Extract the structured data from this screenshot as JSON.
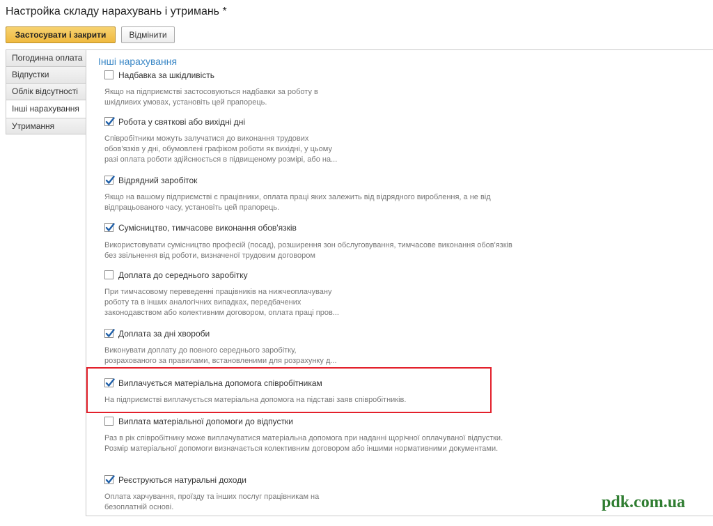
{
  "window": {
    "title": "Настройка складу нарахувань і утримань *"
  },
  "toolbar": {
    "apply_close_label": "Застосувати і закрити",
    "cancel_label": "Відмінити"
  },
  "tabs": [
    {
      "label": "Погодинна оплата",
      "active": false
    },
    {
      "label": "Відпустки",
      "active": false
    },
    {
      "label": "Облік відсутності",
      "active": false
    },
    {
      "label": "Інші нарахування",
      "active": true
    },
    {
      "label": "Утримання",
      "active": false
    }
  ],
  "section": {
    "title": "Інші нарахування"
  },
  "options": [
    {
      "label": "Надбавка за шкідливість",
      "checked": false,
      "description": "Якщо на підприємстві застосовуються надбавки за роботу в\nшкідливих умовах, установіть цей прапорець."
    },
    {
      "label": "Робота у святкові або вихідні дні",
      "checked": true,
      "description": "Співробітники можуть залучатися до виконання трудових\nобов'язків у дні, обумовлені графіком роботи як вихідні, у цьому\nразі оплата роботи здійснюється в підвищеному розмірі, або на..."
    },
    {
      "label": "Відрядний заробіток",
      "checked": true,
      "description": "Якщо на вашому підприємстві є працівники, оплата праці яких залежить від відрядного вироблення, а не від\nвідпрацьованого часу, установіть цей прапорець."
    },
    {
      "label": "Сумісництво, тимчасове виконання обов'язків",
      "checked": true,
      "description": "Використовувати сумісництво професій (посад), розширення зон обслуговування, тимчасове виконання обов'язків\nбез звільнення від роботи, визначеної трудовим договором"
    },
    {
      "label": "Доплата до середнього заробітку",
      "checked": false,
      "description": "При тимчасовому переведенні працівників на нижчеоплачувану\nроботу та в інших аналогічних випадках, передбачених\nзаконодавством або колективним договором, оплата праці пров..."
    },
    {
      "label": "Доплата за дні хвороби",
      "checked": true,
      "description": "Виконувати доплату до повного середнього заробітку,\nрозрахованого за правилами, встановленими для розрахунку д..."
    },
    {
      "label": "Виплачується матеріальна допомога співробітникам",
      "checked": true,
      "description": "На підприємстві виплачується матеріальна допомога на підставі заяв співробітників."
    },
    {
      "label": "Виплата матеріальної допомоги до відпустки",
      "checked": false,
      "description": "Раз в рік співробітнику може виплачуватися матеріальна допомога при наданні щорічної оплачуваної відпустки.\nРозмір матеріальної допомоги визначається колективним договором або іншими нормативними документами."
    },
    {
      "label": "Реєструються натуральні доходи",
      "checked": true,
      "description": "Оплата харчування, проїзду та інших послуг працівникам на\nбезоплатній основі."
    }
  ],
  "watermark": "pdk.com.ua",
  "colors": {
    "accent": "#efb93f",
    "section_title": "#3a87c6",
    "highlight": "#e3202b",
    "check": "#1f5fa8",
    "watermark": "#2f7d31"
  }
}
